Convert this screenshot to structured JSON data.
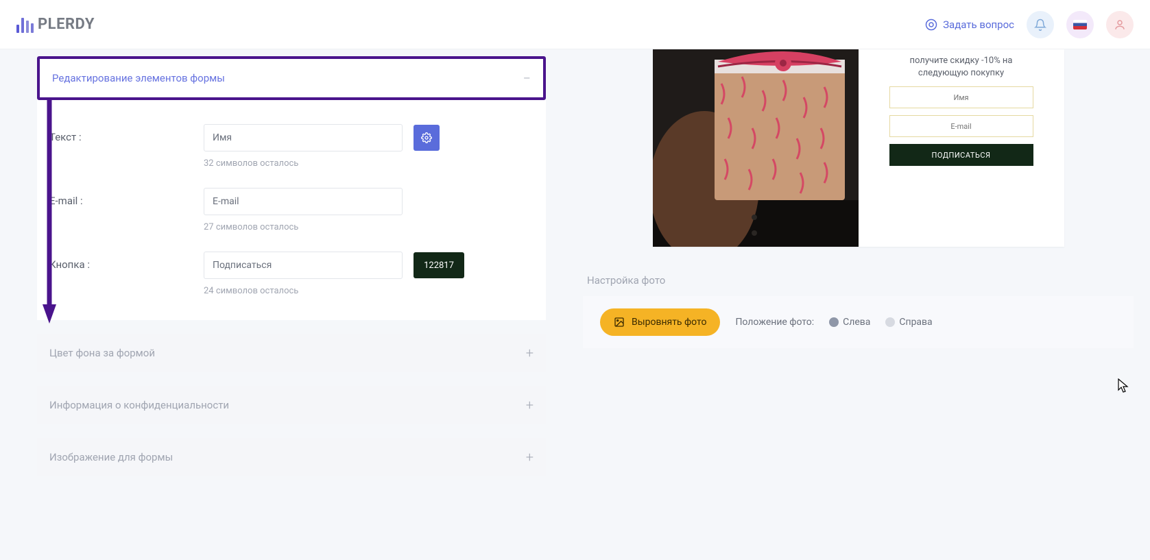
{
  "header": {
    "logo_text": "PLERDY",
    "ask_question": "Задать вопрос"
  },
  "left": {
    "section_edit": {
      "title": "Редактирование элементов формы",
      "fields": {
        "text_label": "Текст :",
        "text_value": "Имя",
        "text_helper": "32 символов осталось",
        "email_label": "E-mail :",
        "email_value": "E-mail",
        "email_helper": "27 символов осталось",
        "button_label": "Кнопка :",
        "button_value": "Подписаться",
        "button_helper": "24 символов осталось",
        "button_color": "122817"
      }
    },
    "section_bg": {
      "title": "Цвет фона за формой"
    },
    "section_privacy": {
      "title": "Информация о конфиденциальности"
    },
    "section_image": {
      "title": "Изображение для формы"
    }
  },
  "preview": {
    "desc1": "получите скидку -10% на",
    "desc2": "следующую покупку",
    "input_name": "Имя",
    "input_email": "E-mail",
    "button": "ПОДПИСАТЬСЯ"
  },
  "photo": {
    "settings_label": "Настройка фото",
    "align_button": "Выровнять фото",
    "position_label": "Положение фото:",
    "radio_left": "Слева",
    "radio_right": "Справа"
  }
}
